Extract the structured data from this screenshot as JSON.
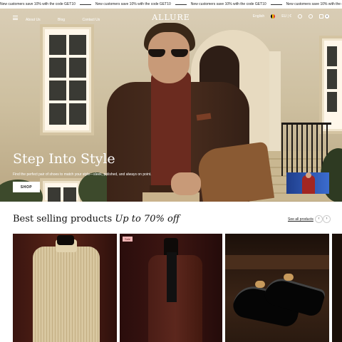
{
  "announcement": {
    "messages": [
      "New customers save 10% with the code GET10",
      "New customers save 10% with the code GET10",
      "New customers save 10% with the code GET10",
      "New customers save 10% with the code GET10"
    ]
  },
  "header": {
    "nav": [
      "About Us",
      "Blog",
      "Contact Us"
    ],
    "logo": "ALLURE",
    "language": "English",
    "currency": "EU | €",
    "cart_count": "0"
  },
  "hero": {
    "title": "Step Into Style",
    "subtitle": "Find the perfect pair of shoes to match your style—sleek, polished, and always on point.",
    "cta": "SHOP"
  },
  "best_selling": {
    "title": "Best selling products",
    "title_em": "Up to 70% off",
    "see_all": "See all products",
    "prev_label": "‹",
    "next_label": "›",
    "cards": [
      {
        "badge": ""
      },
      {
        "badge": "Sale"
      },
      {
        "badge": ""
      }
    ]
  },
  "colors": {
    "hero_text": "#ffffff",
    "heading": "#111111",
    "sale_badge_bg": "#f0b5b5"
  },
  "icons": [
    "menu-icon",
    "flag-icon",
    "search-icon",
    "account-icon",
    "cart-icon",
    "chevron-left-icon",
    "chevron-right-icon"
  ]
}
